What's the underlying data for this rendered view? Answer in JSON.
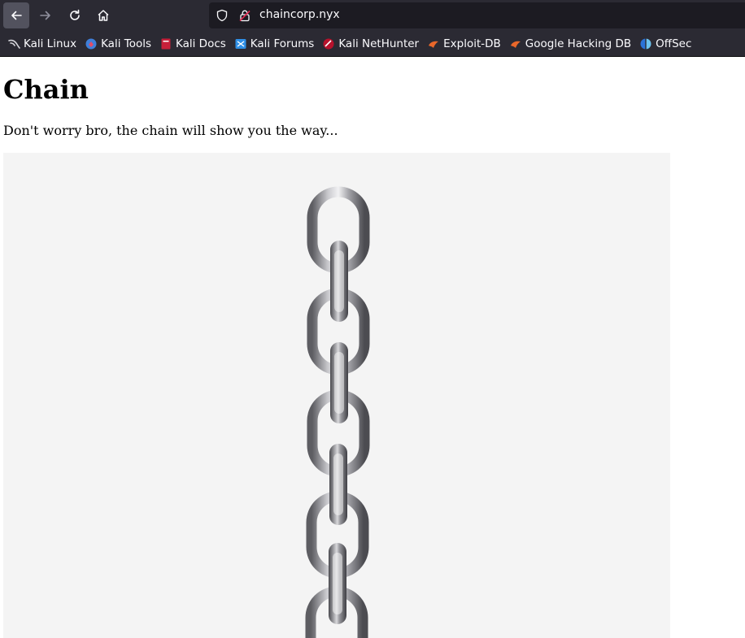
{
  "browser": {
    "url": "chaincorp.nyx",
    "nav": {
      "back_icon": "arrow-left-icon",
      "forward_icon": "arrow-right-icon",
      "reload_icon": "reload-icon",
      "home_icon": "home-icon"
    },
    "bookmarks": [
      {
        "label": "Kali Linux",
        "icon": "kali-dragon-icon"
      },
      {
        "label": "Kali Tools",
        "icon": "kali-tools-icon"
      },
      {
        "label": "Kali Docs",
        "icon": "kali-docs-icon"
      },
      {
        "label": "Kali Forums",
        "icon": "kali-forums-icon"
      },
      {
        "label": "Kali NetHunter",
        "icon": "kali-nethunter-icon"
      },
      {
        "label": "Exploit-DB",
        "icon": "exploit-db-icon"
      },
      {
        "label": "Google Hacking DB",
        "icon": "ghdb-icon"
      },
      {
        "label": "OffSec",
        "icon": "offsec-icon"
      }
    ]
  },
  "page": {
    "title": "Chain",
    "tagline": "Don't worry bro, the chain will show you the way..."
  },
  "colors": {
    "chrome_bg": "#2b2a33",
    "urlbar_bg": "#1c1b22",
    "image_bg": "#f4f4f4",
    "chain_metal": "#8a8a8f"
  }
}
